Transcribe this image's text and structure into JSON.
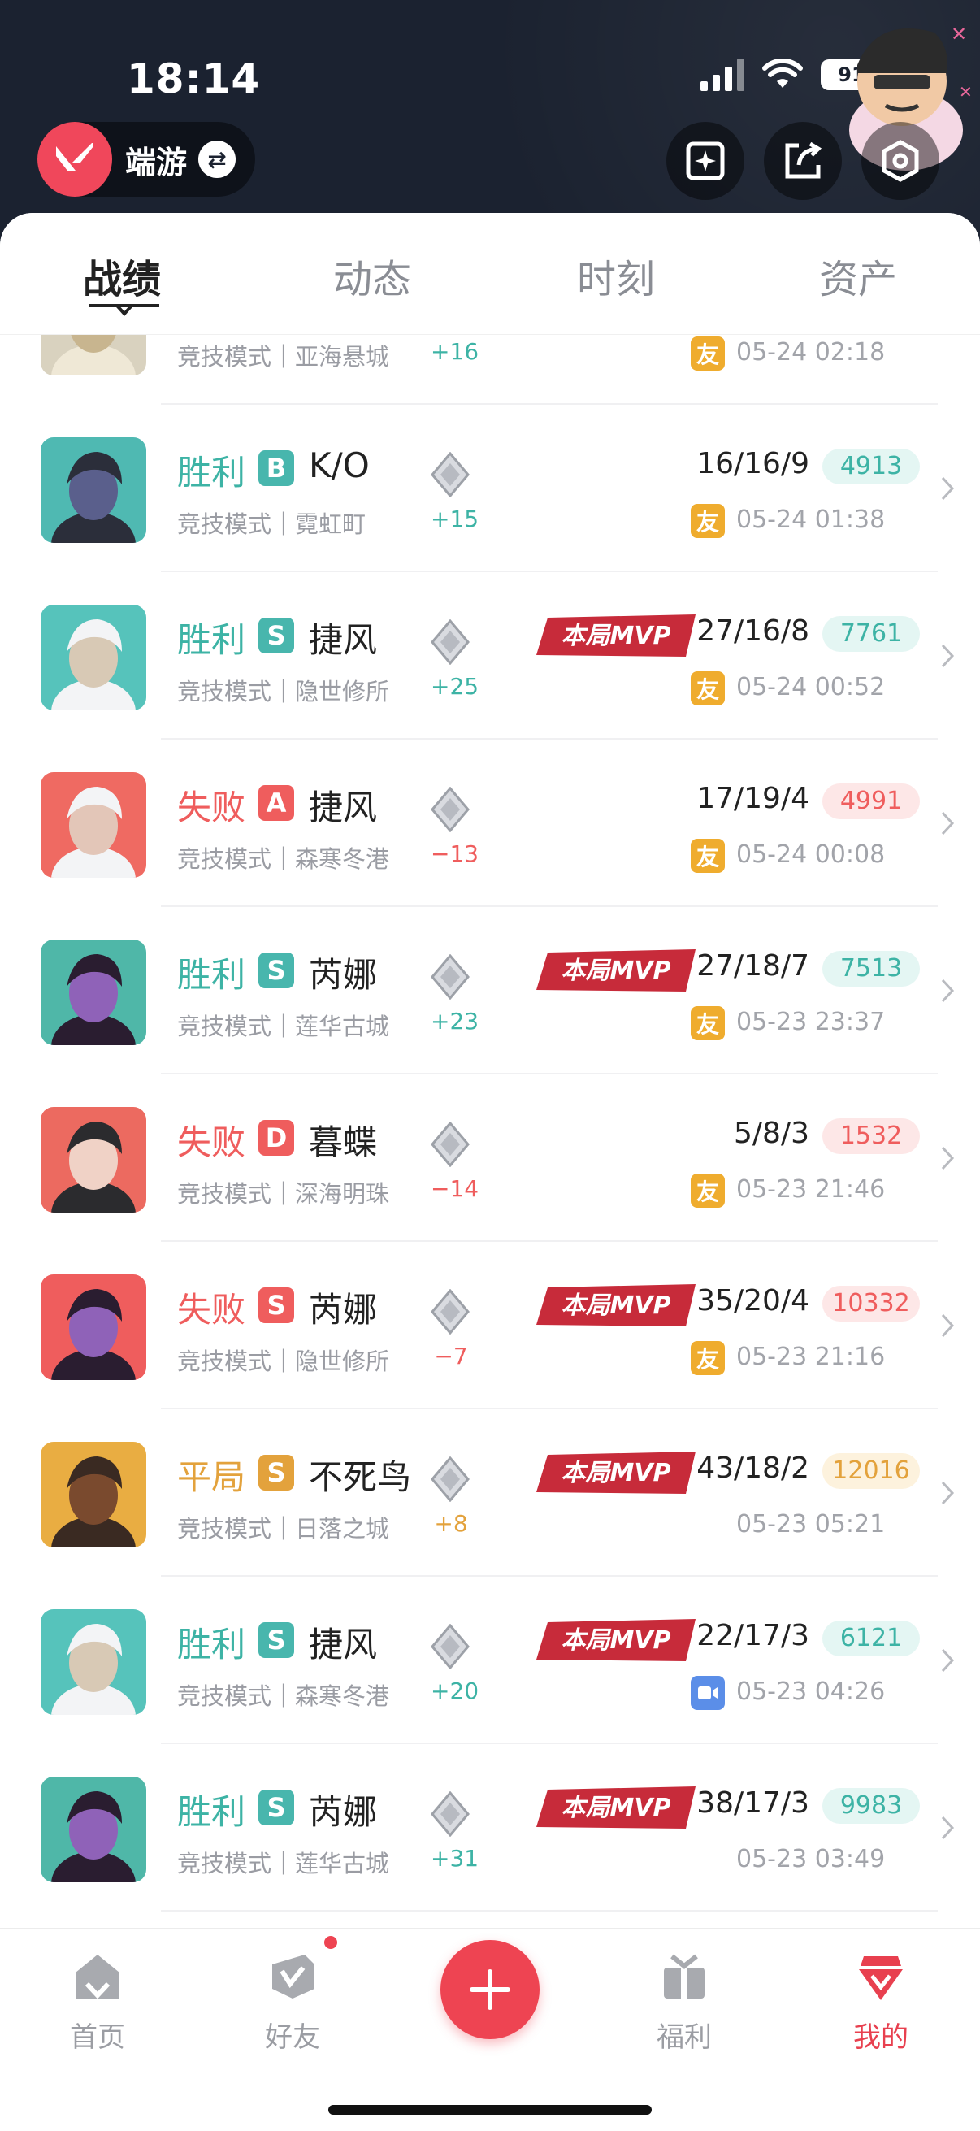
{
  "status": {
    "time": "18:14",
    "battery": "91"
  },
  "header": {
    "game_label": "端游"
  },
  "tabs": [
    {
      "label": "战绩"
    },
    {
      "label": "动态"
    },
    {
      "label": "时刻"
    },
    {
      "label": "资产"
    }
  ],
  "matches": [
    {
      "result": "",
      "grade": "",
      "agent": "",
      "mode": "竞技模式｜亚海悬城",
      "delta": "+16",
      "kda": "",
      "score": "",
      "badge": "友",
      "time": "05-24 02:18",
      "mvp": false,
      "type": "win",
      "avatar": "light"
    },
    {
      "result": "胜利",
      "grade": "B",
      "agent": "K/O",
      "mode": "竞技模式｜霓虹町",
      "delta": "+15",
      "kda": "16/16/9",
      "score": "4913",
      "badge": "友",
      "time": "05-24 01:38",
      "mvp": false,
      "type": "win",
      "avatar": "ko"
    },
    {
      "result": "胜利",
      "grade": "S",
      "agent": "捷风",
      "mode": "竞技模式｜隐世修所",
      "delta": "+25",
      "kda": "27/16/8",
      "score": "7761",
      "badge": "友",
      "time": "05-24 00:52",
      "mvp": true,
      "type": "win",
      "avatar": "jett-teal"
    },
    {
      "result": "失败",
      "grade": "A",
      "agent": "捷风",
      "mode": "竞技模式｜森寒冬港",
      "delta": "−13",
      "kda": "17/19/4",
      "score": "4991",
      "badge": "友",
      "time": "05-24 00:08",
      "mvp": false,
      "type": "lose",
      "avatar": "jett-red"
    },
    {
      "result": "胜利",
      "grade": "S",
      "agent": "芮娜",
      "mode": "竞技模式｜莲华古城",
      "delta": "+23",
      "kda": "27/18/7",
      "score": "7513",
      "badge": "友",
      "time": "05-23 23:37",
      "mvp": true,
      "type": "win",
      "avatar": "reyna-teal"
    },
    {
      "result": "失败",
      "grade": "D",
      "agent": "暮蝶",
      "mode": "竞技模式｜深海明珠",
      "delta": "−14",
      "kda": "5/8/3",
      "score": "1532",
      "badge": "友",
      "time": "05-23 21:46",
      "mvp": false,
      "type": "lose",
      "avatar": "clove-red"
    },
    {
      "result": "失败",
      "grade": "S",
      "agent": "芮娜",
      "mode": "竞技模式｜隐世修所",
      "delta": "−7",
      "kda": "35/20/4",
      "score": "10332",
      "badge": "友",
      "time": "05-23 21:16",
      "mvp": true,
      "type": "lose",
      "avatar": "reyna-red"
    },
    {
      "result": "平局",
      "grade": "S",
      "agent": "不死鸟",
      "mode": "竞技模式｜日落之城",
      "delta": "+8",
      "kda": "43/18/2",
      "score": "12016",
      "badge": "",
      "time": "05-23 05:21",
      "mvp": true,
      "type": "draw",
      "avatar": "phoenix"
    },
    {
      "result": "胜利",
      "grade": "S",
      "agent": "捷风",
      "mode": "竞技模式｜森寒冬港",
      "delta": "+20",
      "kda": "22/17/3",
      "score": "6121",
      "badge": "video",
      "time": "05-23 04:26",
      "mvp": true,
      "type": "win",
      "avatar": "jett-teal"
    },
    {
      "result": "胜利",
      "grade": "S",
      "agent": "芮娜",
      "mode": "竞技模式｜莲华古城",
      "delta": "+31",
      "kda": "38/17/3",
      "score": "9983",
      "badge": "",
      "time": "05-23 03:49",
      "mvp": true,
      "type": "win",
      "avatar": "reyna-teal"
    }
  ],
  "mvp_label": "本局MVP",
  "nav": [
    {
      "label": "首页",
      "icon": "home-icon"
    },
    {
      "label": "好友",
      "icon": "friends-icon"
    },
    {
      "label": "",
      "icon": "plus-icon"
    },
    {
      "label": "福利",
      "icon": "gift-icon"
    },
    {
      "label": "我的",
      "icon": "profile-icon"
    }
  ],
  "colors": {
    "win": "#3db3a5",
    "lose": "#ef5d5d",
    "draw": "#e3a23c",
    "accent": "#ee4452"
  }
}
